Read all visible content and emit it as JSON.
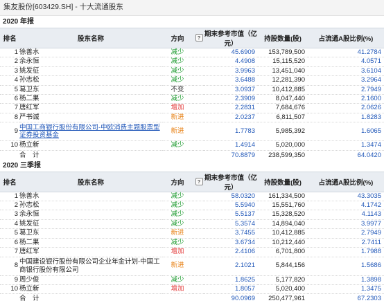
{
  "header": {
    "title": "集友股份[603429.SH] - 十大流通股东"
  },
  "columns": {
    "rank": "排名",
    "name": "股东名称",
    "direction": "方向",
    "help": "?",
    "market_value": "期末参考市值（亿元）",
    "shares": "持股数量(股)",
    "ratio": "占流通A股比例(%)"
  },
  "sections": [
    {
      "title": "2020 年报",
      "rows": [
        {
          "rank": "1",
          "name": "徐善水",
          "direction": "减少",
          "dir_class": "down",
          "value": "45.6909",
          "shares": "153,789,500",
          "ratio": "41.2784"
        },
        {
          "rank": "2",
          "name": "余永恒",
          "direction": "减少",
          "dir_class": "down",
          "value": "4.4908",
          "shares": "15,115,520",
          "ratio": "4.0571"
        },
        {
          "rank": "3",
          "name": "姚发征",
          "direction": "减少",
          "dir_class": "down",
          "value": "3.9963",
          "shares": "13,451,040",
          "ratio": "3.6104"
        },
        {
          "rank": "4",
          "name": "孙志松",
          "direction": "减少",
          "dir_class": "down",
          "value": "3.6488",
          "shares": "12,281,390",
          "ratio": "3.2964"
        },
        {
          "rank": "5",
          "name": "葛卫东",
          "direction": "不变",
          "dir_class": "flat",
          "value": "3.0937",
          "shares": "10,412,885",
          "ratio": "2.7949"
        },
        {
          "rank": "6",
          "name": "杨二果",
          "direction": "减少",
          "dir_class": "down",
          "value": "2.3909",
          "shares": "8,047,440",
          "ratio": "2.1600"
        },
        {
          "rank": "7",
          "name": "唐红军",
          "direction": "增加",
          "dir_class": "up",
          "value": "2.2831",
          "shares": "7,684,676",
          "ratio": "2.0626"
        },
        {
          "rank": "8",
          "name": "严书诚",
          "direction": "新进",
          "dir_class": "new",
          "value": "2.0237",
          "shares": "6,811,507",
          "ratio": "1.8283"
        },
        {
          "rank": "9",
          "name": "中国工商银行股份有限公司-中欧消费主题股票型证券投资基金",
          "direction": "新进",
          "dir_class": "new",
          "value": "1.7783",
          "shares": "5,985,392",
          "ratio": "1.6065",
          "link": true,
          "tall": true
        },
        {
          "rank": "10",
          "name": "杨立新",
          "direction": "减少",
          "dir_class": "down",
          "value": "1.4914",
          "shares": "5,020,000",
          "ratio": "1.3474"
        }
      ],
      "total": {
        "label": "合　计",
        "value": "70.8879",
        "shares": "238,599,350",
        "ratio": "64.0420"
      }
    },
    {
      "title": "2020 三季报",
      "rows": [
        {
          "rank": "1",
          "name": "徐善水",
          "direction": "减少",
          "dir_class": "down",
          "value": "58.0320",
          "shares": "161,334,500",
          "ratio": "43.3035"
        },
        {
          "rank": "2",
          "name": "孙志松",
          "direction": "减少",
          "dir_class": "down",
          "value": "5.5940",
          "shares": "15,551,760",
          "ratio": "4.1742"
        },
        {
          "rank": "3",
          "name": "余永恒",
          "direction": "减少",
          "dir_class": "down",
          "value": "5.5137",
          "shares": "15,328,520",
          "ratio": "4.1143"
        },
        {
          "rank": "4",
          "name": "姚发征",
          "direction": "减少",
          "dir_class": "down",
          "value": "5.3574",
          "shares": "14,894,040",
          "ratio": "3.9977"
        },
        {
          "rank": "5",
          "name": "葛卫东",
          "direction": "新进",
          "dir_class": "new",
          "value": "3.7455",
          "shares": "10,412,885",
          "ratio": "2.7949"
        },
        {
          "rank": "6",
          "name": "杨二果",
          "direction": "减少",
          "dir_class": "down",
          "value": "3.6734",
          "shares": "10,212,440",
          "ratio": "2.7411"
        },
        {
          "rank": "7",
          "name": "唐红军",
          "direction": "增加",
          "dir_class": "up",
          "value": "2.4106",
          "shares": "6,701,800",
          "ratio": "1.7988"
        },
        {
          "rank": "8",
          "name": "中国建设银行股份有限公司企业年金计划-中国工商银行股份有限公司",
          "direction": "新进",
          "dir_class": "new",
          "value": "2.1021",
          "shares": "5,844,156",
          "ratio": "1.5686",
          "link": false,
          "tall": true
        },
        {
          "rank": "9",
          "name": "周少俊",
          "direction": "减少",
          "dir_class": "down",
          "value": "1.8625",
          "shares": "5,177,820",
          "ratio": "1.3898"
        },
        {
          "rank": "10",
          "name": "杨立新",
          "direction": "增加",
          "dir_class": "up",
          "value": "1.8057",
          "shares": "5,020,400",
          "ratio": "1.3475"
        }
      ],
      "total": {
        "label": "合　计",
        "value": "90.0969",
        "shares": "250,477,961",
        "ratio": "67.2303"
      }
    }
  ]
}
